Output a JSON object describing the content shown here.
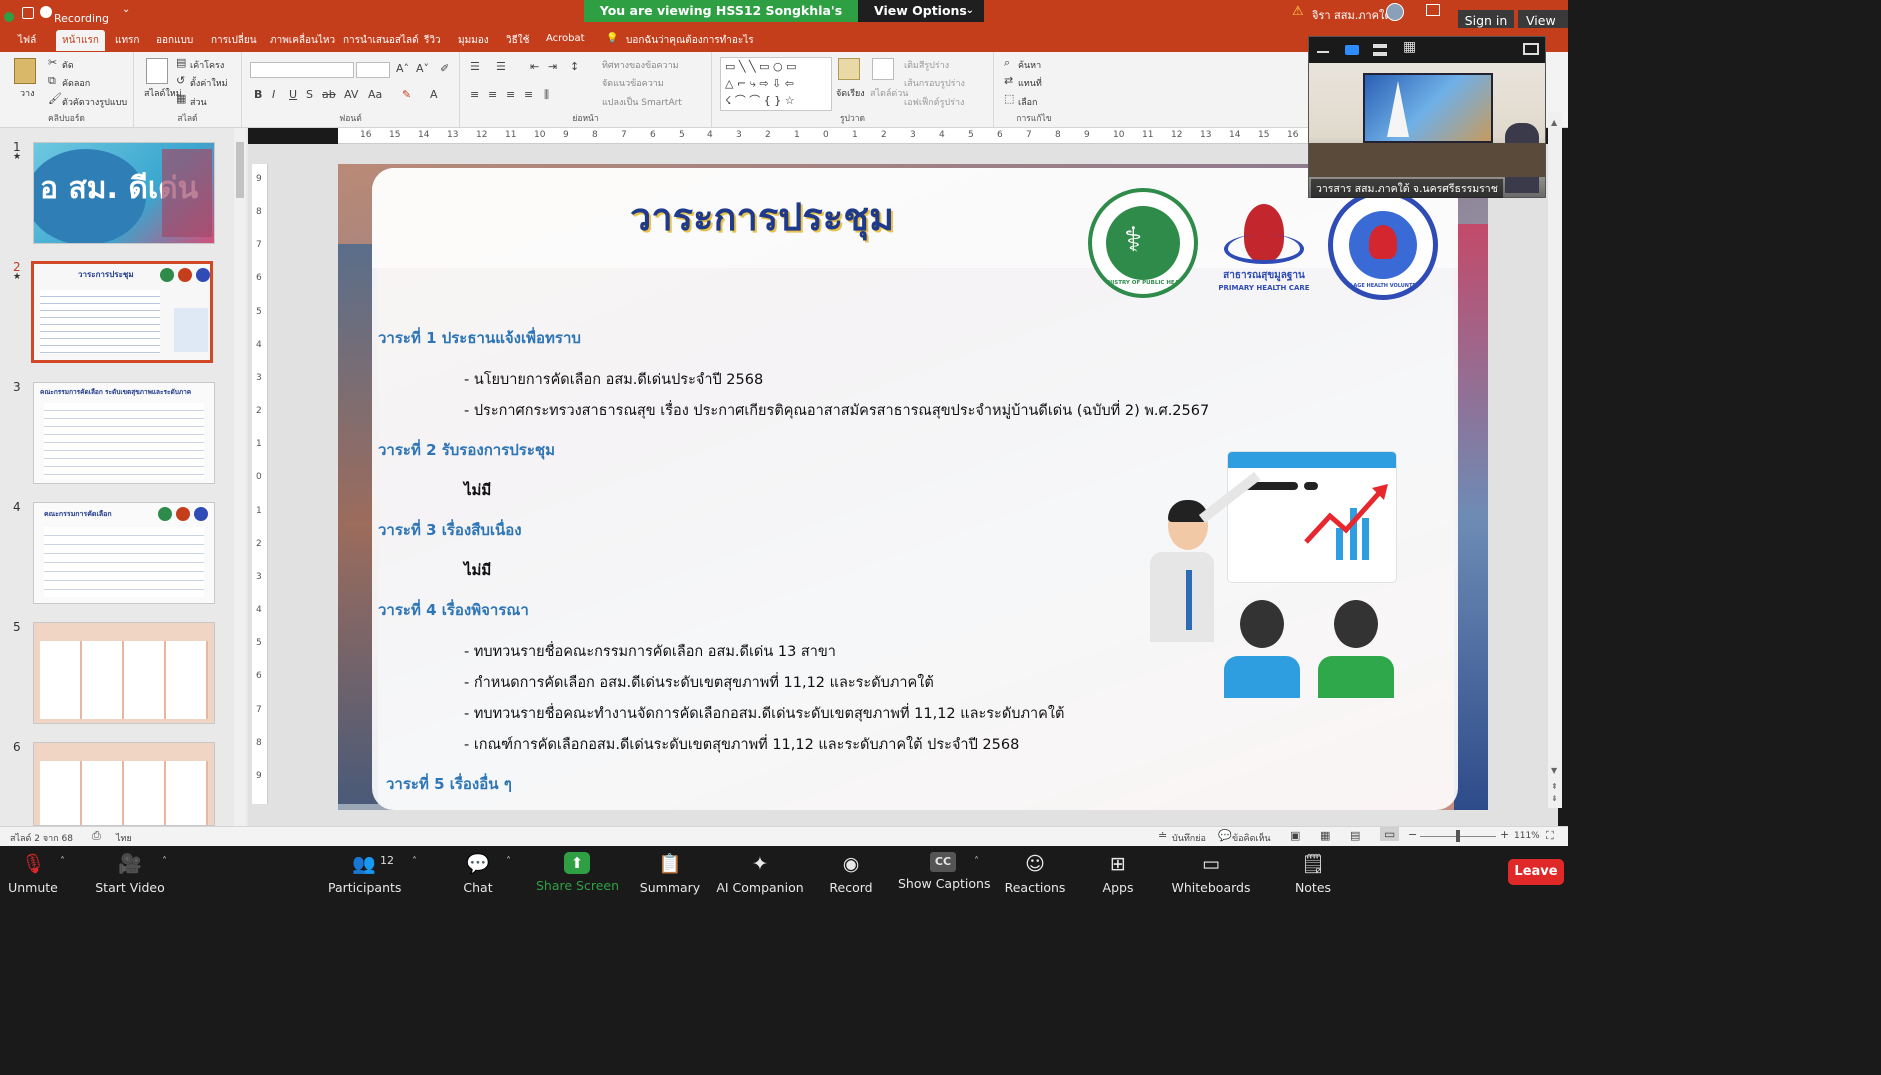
{
  "zoom_banner": {
    "text": "You are viewing HSS12 Songkhla's screen",
    "view_options": "View Options"
  },
  "titlebar": {
    "recording": "Recording",
    "user": "จิรา สสม.ภาคใต้",
    "sign_in": "Sign in",
    "view": "View"
  },
  "ribbon_tabs": [
    "ไฟล์",
    "หน้าแรก",
    "แทรก",
    "ออกแบบ",
    "การเปลี่ยน",
    "ภาพเคลื่อนไหว",
    "การนำเสนอสไลด์",
    "รีวิว",
    "มุมมอง",
    "วิธีใช้",
    "Acrobat",
    "บอกฉันว่าคุณต้องการทำอะไร"
  ],
  "ribbon": {
    "clipboard": {
      "label": "คลิปบอร์ด",
      "paste": "วาง",
      "cut": "ตัด",
      "copy": "คัดลอก",
      "format_painter": "ตัวคัดวางรูปแบบ"
    },
    "slides": {
      "label": "สไลด์",
      "new_slide": "สไลด์ใหม่",
      "layout": "เค้าโครง",
      "reset": "ตั้งค่าใหม่",
      "section": "ส่วน"
    },
    "font": {
      "label": "ฟอนต์"
    },
    "paragraph": {
      "label": "ย่อหน้า",
      "text_direction": "ทิศทางของข้อความ",
      "align_text": "จัดแนวข้อความ",
      "smartart": "แปลงเป็น SmartArt"
    },
    "drawing": {
      "label": "รูปวาด",
      "arrange": "จัดเรียง",
      "quick_styles": "สไตล์ด่วน",
      "shape_fill": "เติมสีรูปร่าง",
      "shape_outline": "เส้นกรอบรูปร่าง",
      "shape_effects": "เอฟเฟ็กต์รูปร่าง"
    },
    "editing": {
      "label": "การแก้ไข",
      "find": "ค้นหา",
      "replace": "แทนที่",
      "select": "เลือก"
    }
  },
  "slides_pane": [
    {
      "num": "1",
      "title": "อ สม. ดีเด่น"
    },
    {
      "num": "2",
      "title": "วาระการประชุม"
    },
    {
      "num": "3",
      "title": "คณะกรรมการคัดเลือก ระดับเขตสุขภาพและระดับภาค"
    },
    {
      "num": "4",
      "title": "คณะกรรมการคัดเลือก"
    },
    {
      "num": "5",
      "title": ""
    },
    {
      "num": "6",
      "title": ""
    }
  ],
  "slide": {
    "title": "วาระการประชุม",
    "logos": {
      "moph": "MINISTRY OF PUBLIC HEALTH",
      "phc": "PRIMARY HEALTH CARE",
      "phc_thai": "สาธารณสุขมูลฐาน",
      "vhv": "VILLAGE HEALTH VOLUNTEERS"
    },
    "agenda1": "วาระที่ 1 ประธานแจ้งเพื่อทราบ",
    "agenda1_items": [
      "- นโยบายการคัดเลือก อสม.ดีเด่นประจำปี 2568",
      "- ประกาศกระทรวงสาธารณสุข เรื่อง ประกาศเกียรติคุณอาสาสมัครสาธารณสุขประจำหมู่บ้านดีเด่น (ฉบับที่ 2) พ.ศ.2567"
    ],
    "agenda2": "วาระที่ 2 รับรองการประชุม",
    "agenda2_none": "ไม่มี",
    "agenda3": "วาระที่ 3 เรื่องสืบเนื่อง",
    "agenda3_none": "ไม่มี",
    "agenda4": "วาระที่ 4 เรื่องพิจารณา",
    "agenda4_items": [
      "- ทบทวนรายชื่อคณะกรรมการคัดเลือก อสม.ดีเด่น 13 สาขา",
      "- กำหนดการคัดเลือก อสม.ดีเด่นระดับเขตสุขภาพที่ 11,12 และระดับภาคใต้",
      "- ทบทวนรายชื่อคณะทำงานจัดการคัดเลือกอสม.ดีเด่นระดับเขตสุขภาพที่ 11,12 และระดับภาคใต้",
      "- เกณฑ์การคัดเลือกอสม.ดีเด่นระดับเขตสุขภาพที่ 11,12 และระดับภาคใต้ ประจำปี 2568"
    ],
    "agenda5": "วาระที่ 5 เรื่องอื่น ๆ"
  },
  "video_tile": {
    "name": "วารสาร สสม.ภาคใต้ จ.นครศรีธรรมราช"
  },
  "statusbar": {
    "slide_of": "สไลด์ 2 จาก 68",
    "language": "ไทย",
    "notes": "บันทึกย่อ",
    "comments": "ข้อคิดเห็น",
    "zoom": "111%"
  },
  "hruler_ticks": [
    "16",
    "15",
    "14",
    "13",
    "12",
    "11",
    "10",
    "9",
    "8",
    "7",
    "6",
    "5",
    "4",
    "3",
    "2",
    "1",
    "0",
    "1",
    "2",
    "3",
    "4",
    "5",
    "6",
    "7",
    "8",
    "9",
    "10",
    "11",
    "12",
    "13",
    "14",
    "15",
    "16"
  ],
  "vruler_ticks": [
    "9",
    "8",
    "7",
    "6",
    "5",
    "4",
    "3",
    "2",
    "1",
    "0",
    "1",
    "2",
    "3",
    "4",
    "5",
    "6",
    "7",
    "8",
    "9"
  ],
  "zoom_toolbar": {
    "unmute": "Unmute",
    "start_video": "Start Video",
    "participants": "Participants",
    "participants_count": "12",
    "chat": "Chat",
    "share_screen": "Share Screen",
    "summary": "Summary",
    "ai_companion": "AI Companion",
    "record": "Record",
    "show_captions": "Show Captions",
    "reactions": "Reactions",
    "apps": "Apps",
    "whiteboards": "Whiteboards",
    "notes": "Notes",
    "leave": "Leave"
  },
  "colors": {
    "ppt_red": "#c43e1c",
    "zoom_green": "#2ea043",
    "leave_red": "#e02828",
    "agenda_blue": "#2e75b6",
    "title_navy": "#1f3a8a"
  }
}
